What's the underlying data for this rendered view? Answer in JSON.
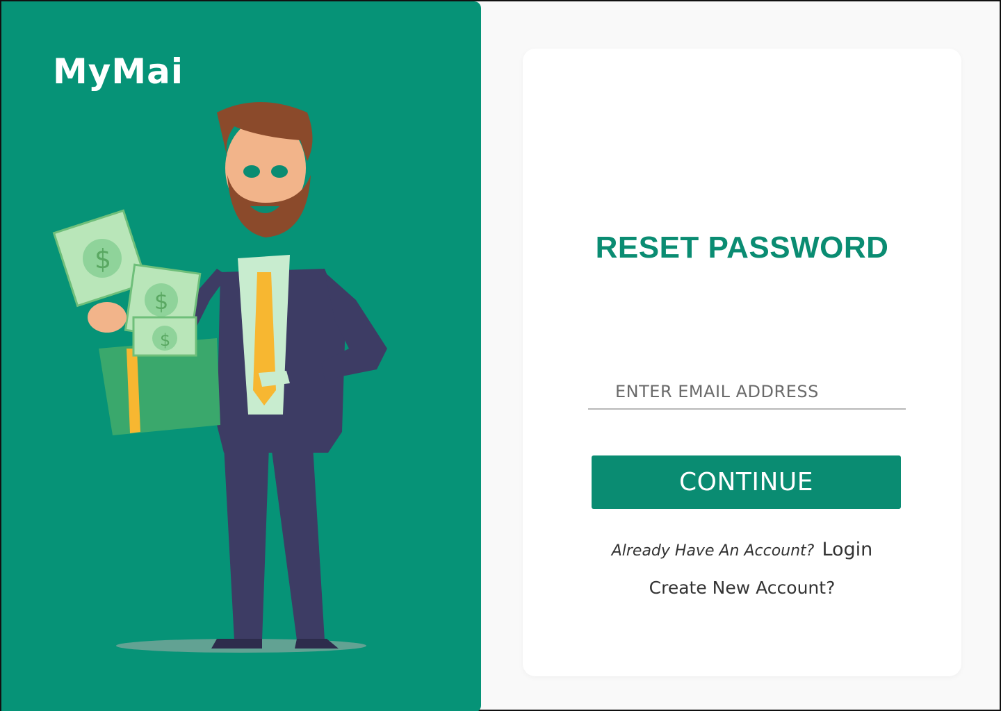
{
  "brand": {
    "logo_text": "MyMai"
  },
  "illustration": {
    "description_icon": "businessman-with-money-icon"
  },
  "form": {
    "title": "RESET PASSWORD",
    "email_placeholder": "ENTER EMAIL ADDRESS",
    "email_value": "",
    "continue_label": "CONTINUE",
    "login_prompt": "Already Have An Account?",
    "login_link": "Login",
    "create_account_link": "Create New Account?"
  },
  "colors": {
    "brand_green": "#069377",
    "title_green": "#0a8c72",
    "card_bg": "#ffffff",
    "page_bg": "#f9f9f9"
  }
}
